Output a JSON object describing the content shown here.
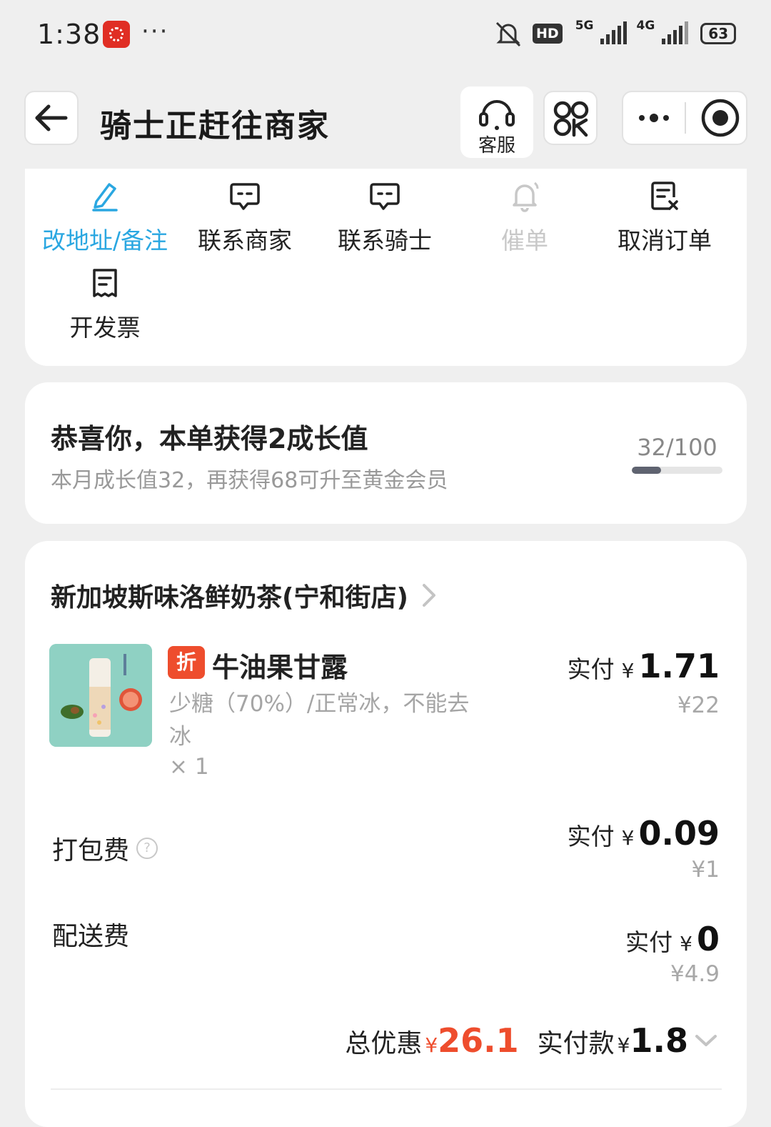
{
  "status_bar": {
    "time": "1:38",
    "more": "···",
    "hd_badge": "HD",
    "net_5g": "5G",
    "net_4g": "4G",
    "battery": "63"
  },
  "header": {
    "title": "骑士正赶往商家",
    "service_label": "客服",
    "more": "···"
  },
  "actions": [
    {
      "label": "改地址/备注",
      "icon": "edit-icon",
      "color": "#2aa7e1"
    },
    {
      "label": "联系商家",
      "icon": "chat-icon"
    },
    {
      "label": "联系骑士",
      "icon": "chat-icon"
    },
    {
      "label": "催单",
      "icon": "bell-icon",
      "disabled": true
    },
    {
      "label": "取消订单",
      "icon": "cancel-doc-icon"
    },
    {
      "label": "开发票",
      "icon": "receipt-icon"
    }
  ],
  "growth": {
    "title": "恭喜你，本单获得2成长值",
    "subtitle": "本月成长值32，再获得68可升至黄金会员",
    "progress_text": "32/100",
    "progress": 0.32
  },
  "order": {
    "store_name": "新加坡斯味洛鲜奶茶(宁和街店)",
    "item": {
      "discount_tag": "折",
      "name": "牛油果甘露",
      "spec_line1": "少糖（70%）/正常冰，不能去",
      "spec_line2": "冰",
      "qty": "× 1",
      "paid_label": "实付",
      "currency": "¥",
      "paid_amount": "1.71",
      "original": "¥22"
    },
    "fees": [
      {
        "label": "打包费",
        "paid_label": "实付",
        "currency": "¥",
        "amount": "0.09",
        "original": "¥1"
      },
      {
        "label": "配送费",
        "paid_label": "实付",
        "currency": "¥",
        "amount": "0",
        "original": "¥4.9"
      }
    ],
    "summary": {
      "discount_label": "总优惠",
      "discount_currency": "¥",
      "discount_amount": "26.1",
      "total_label": "实付款",
      "total_currency": "¥",
      "total_amount": "1.8"
    }
  },
  "colors": {
    "accent_blue": "#2aa7e1",
    "discount_red": "#ee4d2d",
    "disabled_gray": "#c8c8c8"
  }
}
